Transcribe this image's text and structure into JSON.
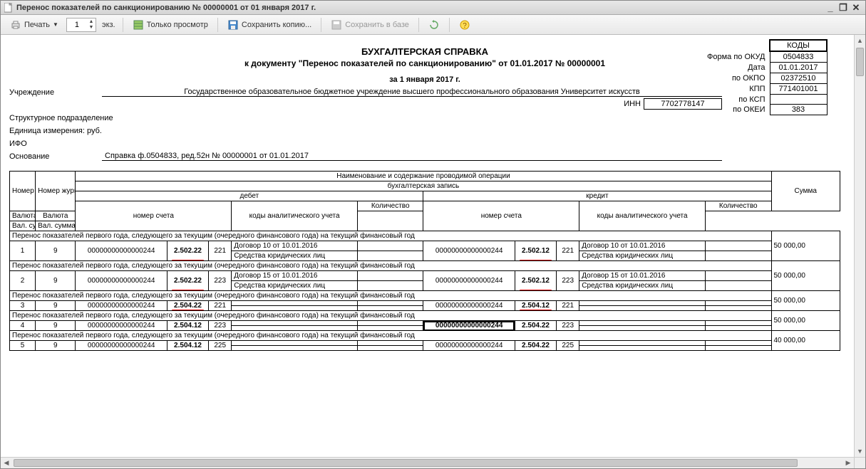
{
  "window": {
    "title": "Перенос показателей по санкционированию № 00000001 от 01 января 2017 г."
  },
  "toolbar": {
    "print": "Печать",
    "copies_value": "1",
    "copies_label": "экз.",
    "preview_only": "Только просмотр",
    "save_copy": "Сохранить копию...",
    "save_to_db": "Сохранить в базе"
  },
  "header": {
    "title": "БУХГАЛТЕРСКАЯ СПРАВКА",
    "subtitle": "к документу \"Перенос показателей по санкционированию\" от 01.01.2017 № 00000001",
    "date_line": "за 1 января 2017 г.",
    "org_label": "Учреждение",
    "org_name": "Государственное образовательное бюджетное учреждение высшего профессионального образования Университет искусств",
    "inn_label": "ИНН",
    "inn": "7702778147",
    "subdiv_label": "Структурное подразделение",
    "unit_label": "Единица измерения: руб.",
    "ifo_label": "ИФО",
    "basis_label": "Основание",
    "basis_text": "Справка ф.0504833, ред.52н № 00000001 от 01.01.2017"
  },
  "codes": {
    "head": "КОДЫ",
    "okud_lbl": "Форма  по ОКУД",
    "okud": "0504833",
    "date_lbl": "Дата",
    "date": "01.01.2017",
    "okpo_lbl": "по ОКПО",
    "okpo": "02372510",
    "kpp_lbl": "КПП",
    "kpp": "771401001",
    "ksp_lbl": "по КСП",
    "ksp": "",
    "okei_lbl": "по ОКЕИ",
    "okei": "383"
  },
  "table_headers": {
    "num": "Номер п/п",
    "journal": "Номер журнала",
    "operation": "Наименование и содержание проводимой операции",
    "entry": "бухгалтерская запись",
    "debit": "дебет",
    "credit": "кредит",
    "account": "номер счета",
    "analytics": "коды аналитического учета",
    "qty": "Количество",
    "currency": "Валюта",
    "valsum": "Вал. сумма",
    "sum": "Сумма"
  },
  "section_text": "Перенос показателей первого года, следующего за текущим (очередного финансового года) на текущий финансовый год",
  "rows": [
    {
      "num": "1",
      "journal": "9",
      "d_acc": "00000000000000244",
      "d_code": "2.502.22",
      "d_red": true,
      "d_suf": "221",
      "d_an1": "Договор 10 от 10.01.2016",
      "d_an2": "Средства юридических лиц",
      "c_acc": "00000000000000244",
      "c_code": "2.502.12",
      "c_red": true,
      "c_suf": "221",
      "c_an1": "Договор 10 от 10.01.2016",
      "c_an2": "Средства юридических лиц",
      "sum": "50 000,00"
    },
    {
      "num": "2",
      "journal": "9",
      "d_acc": "00000000000000244",
      "d_code": "2.502.22",
      "d_red": true,
      "d_suf": "223",
      "d_an1": "Договор 15 от 10.01.2016",
      "d_an2": "Средства юридических лиц",
      "c_acc": "00000000000000244",
      "c_code": "2.502.12",
      "c_red": true,
      "c_suf": "223",
      "c_an1": "Договор 15 от 10.01.2016",
      "c_an2": "Средства юридических лиц",
      "sum": "50 000,00"
    },
    {
      "num": "3",
      "journal": "9",
      "d_acc": "00000000000000244",
      "d_code": "2.504.22",
      "d_red": true,
      "d_suf": "221",
      "d_an1": "",
      "d_an2": "",
      "c_acc": "00000000000000244",
      "c_code": "2.504.12",
      "c_red": true,
      "c_suf": "221",
      "c_an1": "",
      "c_an2": "",
      "sum": "50 000,00"
    },
    {
      "num": "4",
      "journal": "9",
      "d_acc": "00000000000000244",
      "d_code": "2.504.12",
      "d_red": false,
      "d_suf": "223",
      "d_an1": "",
      "d_an2": "",
      "c_acc": "00000000000000244",
      "c_code": "2.504.22",
      "c_red": false,
      "c_suf": "223",
      "c_an1": "",
      "c_an2": "",
      "c_acc_selected": true,
      "sum": "50 000,00"
    },
    {
      "num": "5",
      "journal": "9",
      "d_acc": "00000000000000244",
      "d_code": "2.504.12",
      "d_red": false,
      "d_suf": "225",
      "d_an1": "",
      "d_an2": "",
      "c_acc": "00000000000000244",
      "c_code": "2.504.22",
      "c_red": false,
      "c_suf": "225",
      "c_an1": "",
      "c_an2": "",
      "sum": "40 000,00"
    }
  ]
}
